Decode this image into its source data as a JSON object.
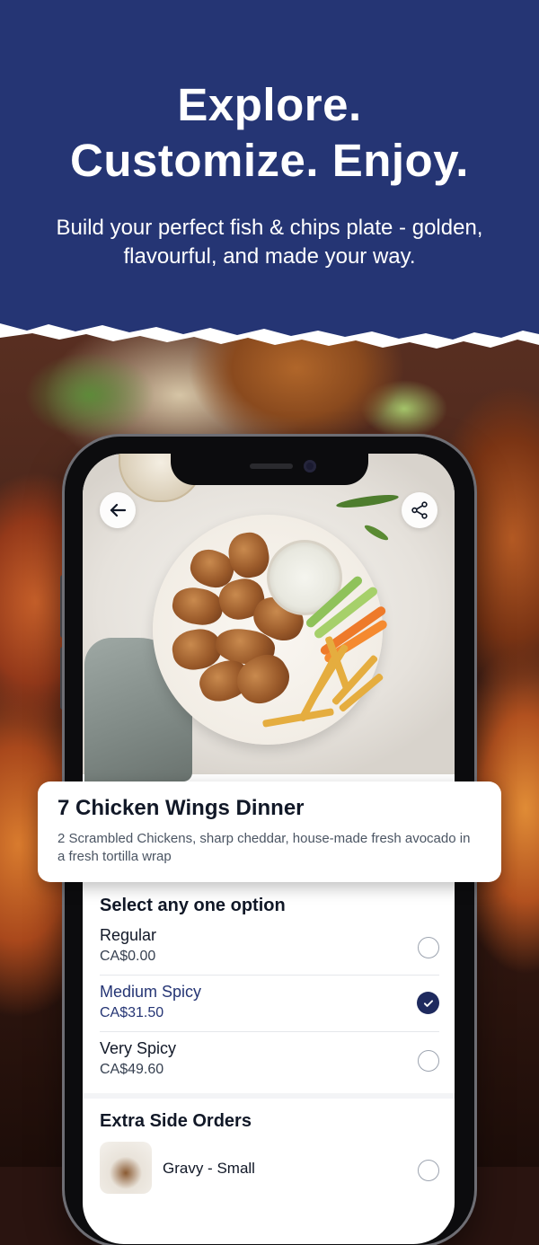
{
  "promo": {
    "headline_line1": "Explore.",
    "headline_line2": "Customize. Enjoy.",
    "subheadline": "Build your perfect fish & chips plate - golden, flavourful, and made your way."
  },
  "colors": {
    "header_bg": "#253574",
    "accent": "#1e2a5e",
    "text_primary": "#111827"
  },
  "icons": {
    "back": "arrow-left-icon",
    "share": "share-icon",
    "check": "check-icon"
  },
  "item": {
    "title": "7 Chicken Wings Dinner",
    "description": "2 Scrambled Chickens, sharp cheddar, house-made fresh avocado in a fresh tortilla wrap"
  },
  "options": {
    "section_title": "Select any one option",
    "items": [
      {
        "name": "Regular",
        "price": "CA$0.00",
        "selected": false
      },
      {
        "name": "Medium Spicy",
        "price": "CA$31.50",
        "selected": true
      },
      {
        "name": "Very Spicy",
        "price": "CA$49.60",
        "selected": false
      }
    ]
  },
  "side_orders": {
    "section_title": "Extra Side Orders",
    "items": [
      {
        "name": "Gravy - Small"
      }
    ]
  }
}
